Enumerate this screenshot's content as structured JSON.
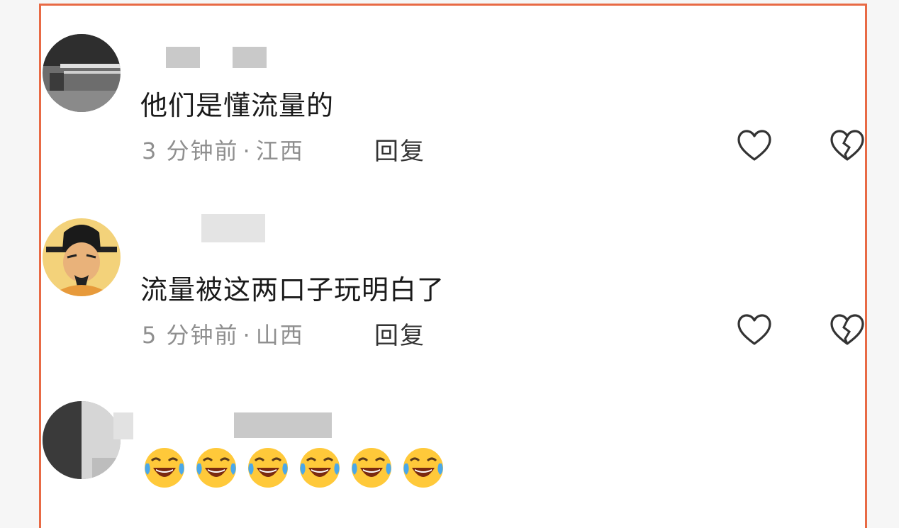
{
  "comments": [
    {
      "text": "他们是懂流量的",
      "time": "3 分钟前",
      "location": "江西",
      "reply_label": "回复"
    },
    {
      "text": "流量被这两口子玩明白了",
      "time": "5 分钟前",
      "location": "山西",
      "reply_label": "回复"
    },
    {
      "emoji": "laughing-crying-emoji",
      "emoji_count": 6
    }
  ],
  "icons": {
    "like": "heart-outline-icon",
    "dislike": "broken-heart-icon"
  },
  "colors": {
    "frame": "#e86a45",
    "meta_text": "#8f8f8f",
    "body_text": "#1a1a1a"
  }
}
